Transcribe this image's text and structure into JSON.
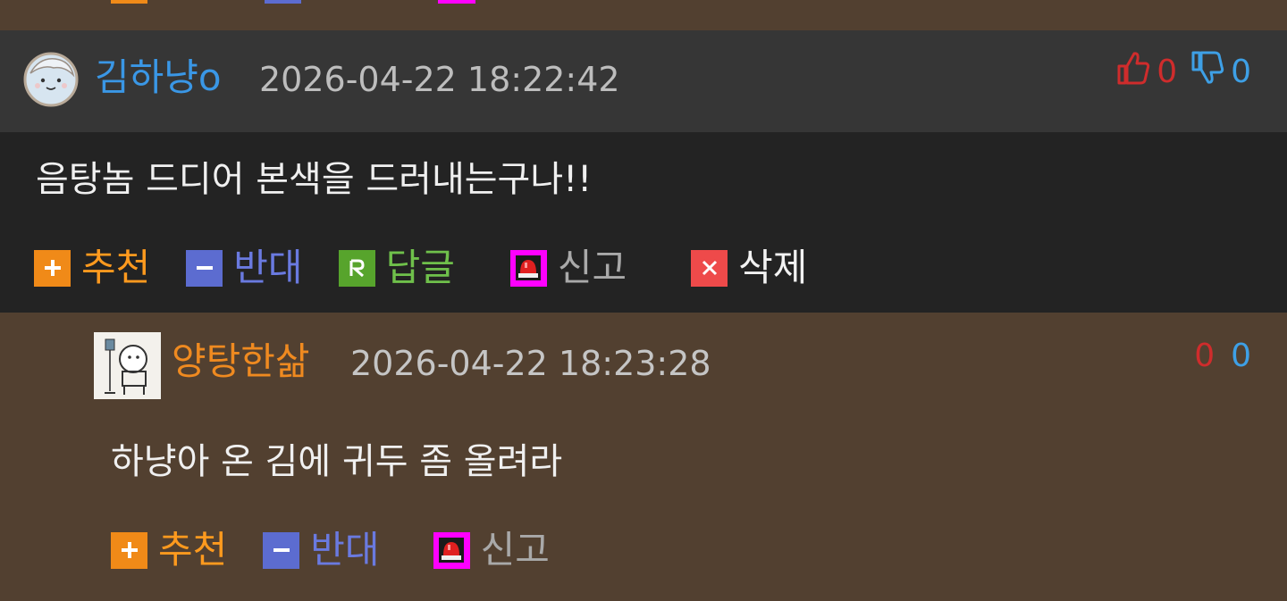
{
  "colors": {
    "page_bg": "#524030",
    "comment_head_bg": "#363636",
    "comment_body_bg": "#232323",
    "recommend": "#ff9a1e",
    "oppose": "#6a7ae0",
    "reply": "#6fc04b",
    "report": "#ff00ff",
    "delete": "#ee4a4a",
    "nick_blue": "#3a97e6",
    "nick_orange": "#ef8a20"
  },
  "comments": [
    {
      "nickname": "김하냥o",
      "datetime": "2026-04-22 18:22:42",
      "up_count": "0",
      "down_count": "0",
      "up_icon": "thumbs-up-icon",
      "down_icon": "thumbs-down-icon",
      "text": "음탕놈 드디어 본색을 드러내는구나!!",
      "actions": {
        "recommend": "추천",
        "oppose": "반대",
        "reply": "답글",
        "report": "신고",
        "delete": "삭제"
      }
    },
    {
      "nickname": "양탕한삶",
      "datetime": "2026-04-22 18:23:28",
      "up_count": "0",
      "down_count": "0",
      "text": "하냥아 온 김에 귀두 좀 올려라",
      "actions": {
        "recommend": "추천",
        "oppose": "반대",
        "report": "신고"
      }
    }
  ]
}
